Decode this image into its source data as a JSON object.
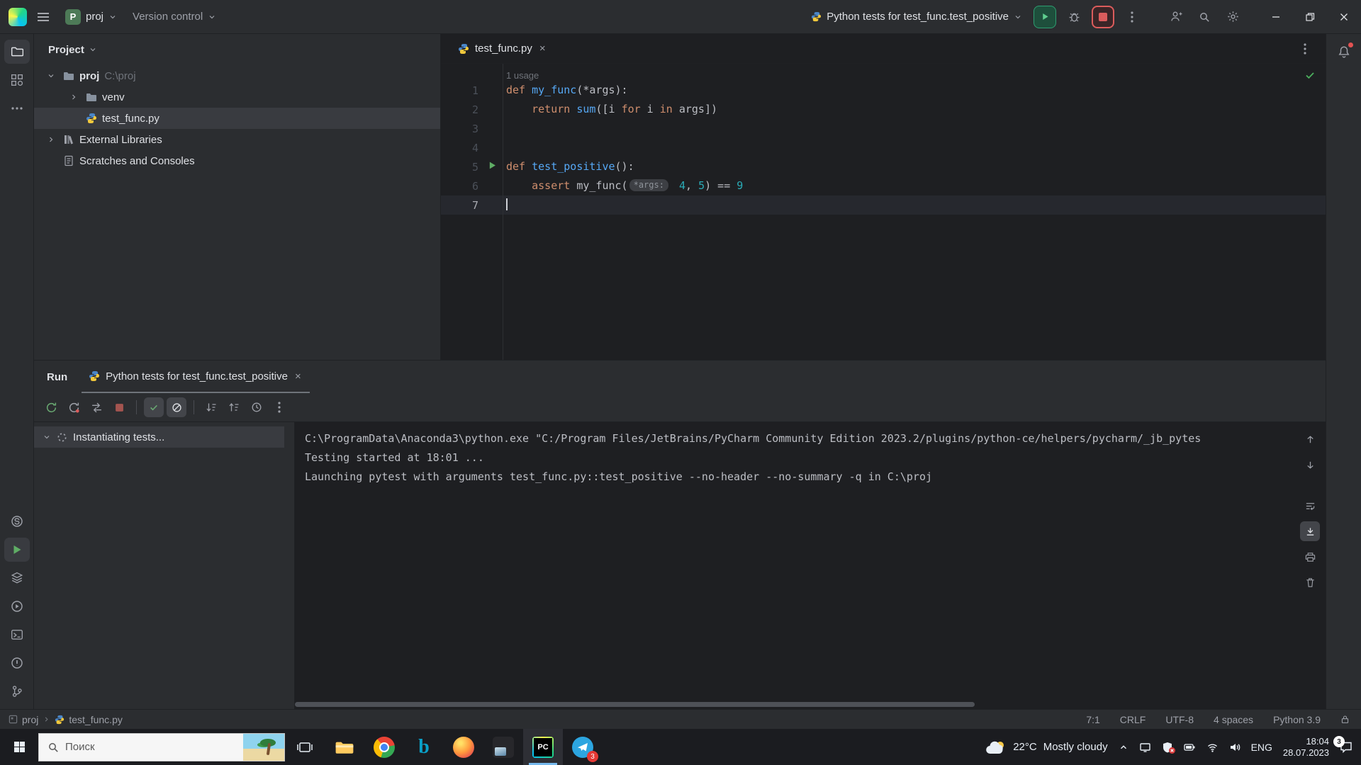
{
  "titlebar": {
    "project": "proj",
    "vcs": "Version control",
    "run_config": "Python tests for test_func.test_positive"
  },
  "project_panel": {
    "title": "Project",
    "root_name": "proj",
    "root_path": "C:\\proj",
    "venv": "venv",
    "file": "test_func.py",
    "external": "External Libraries",
    "scratches": "Scratches and Consoles"
  },
  "editor": {
    "tab": "test_func.py",
    "usages": "1 usage",
    "gutter": {
      "n1": "1",
      "n2": "2",
      "n3": "3",
      "n4": "4",
      "n5": "5",
      "n6": "6",
      "n7": "7"
    },
    "code": {
      "l1": {
        "t0": "def ",
        "t1": "my_func",
        "t2": "(*args):"
      },
      "l2": {
        "t0": "    ",
        "t1": "return",
        "t2": " ",
        "t3": "sum",
        "t4": "([i ",
        "t5": "for",
        "t6": " i ",
        "t7": "in",
        "t8": " args])"
      },
      "l5": {
        "t0": "def ",
        "t1": "test_positive",
        "t2": "():"
      },
      "l6": {
        "t0": "    ",
        "t1": "assert",
        "t2": " my_func(",
        "hint": "*args:",
        "t3": " 4",
        "t4": ",",
        "t5": " 5",
        "t6": ") == ",
        "t7": "9"
      }
    }
  },
  "run_panel": {
    "title": "Run",
    "tab": "Python tests for test_func.test_positive",
    "tree_item": "Instantiating tests...",
    "console": {
      "line1": "C:\\ProgramData\\Anaconda3\\python.exe \"C:/Program Files/JetBrains/PyCharm Community Edition 2023.2/plugins/python-ce/helpers/pycharm/_jb_pytes",
      "line2": "Testing started at 18:01 ...",
      "line3": "Launching pytest with arguments test_func.py::test_positive --no-header --no-summary -q in C:\\proj"
    }
  },
  "statusbar": {
    "breadcrumb_root": "proj",
    "breadcrumb_file": "test_func.py",
    "cursor": "7:1",
    "line_ending": "CRLF",
    "encoding": "UTF-8",
    "indent": "4 spaces",
    "interpreter": "Python 3.9"
  },
  "taskbar": {
    "search": "Поиск",
    "weather_temp": "22°C",
    "weather_desc": "Mostly cloudy",
    "language": "ENG",
    "time": "18:04",
    "date": "28.07.2023",
    "notifications": "3",
    "telegram_badge": "3"
  },
  "colors": {
    "keyword": "#cf8e6d",
    "function": "#56a8f5",
    "number": "#2aacb8",
    "run_green": "#5fce8f",
    "stop_red": "#db5c5c"
  }
}
